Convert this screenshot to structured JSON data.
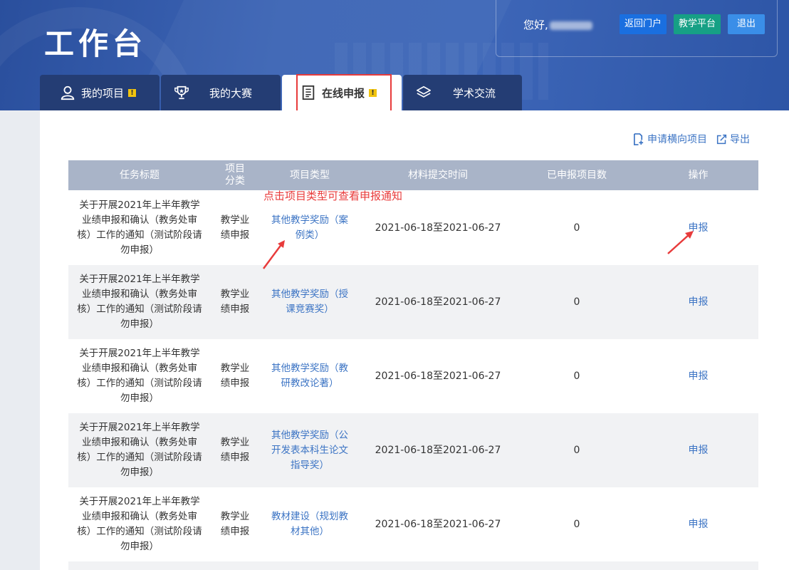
{
  "header": {
    "title": "工作台",
    "greeting": "您好,",
    "buttons": {
      "portal": "返回门户",
      "platform": "教学平台",
      "logout": "退出"
    }
  },
  "tabs": [
    {
      "label": "我的项目",
      "icon": "user-icon",
      "alert": "!"
    },
    {
      "label": "我的大赛",
      "icon": "trophy-icon"
    },
    {
      "label": "在线申报",
      "icon": "document-icon",
      "alert": "!",
      "active": true
    },
    {
      "label": "学术交流",
      "icon": "layers-icon"
    }
  ],
  "toolbar": {
    "apply_label": "申请横向项目",
    "export_label": "导出"
  },
  "annotation": "点击项目类型可查看申报通知",
  "table": {
    "headers": {
      "title": "任务标题",
      "category": "项目分类",
      "type": "项目类型",
      "time": "材料提交时间",
      "count": "已申报项目数",
      "op": "操作"
    },
    "rows": [
      {
        "title": "关于开展2021年上半年教学业绩申报和确认（教务处审核）工作的通知（测试阶段请勿申报）",
        "category": "教学业绩申报",
        "type": "其他教学奖励（案例类）",
        "time": "2021-06-18至2021-06-27",
        "count": "0",
        "op": "申报"
      },
      {
        "title": "关于开展2021年上半年教学业绩申报和确认（教务处审核）工作的通知（测试阶段请勿申报）",
        "category": "教学业绩申报",
        "type": "其他教学奖励（授课竞赛奖）",
        "time": "2021-06-18至2021-06-27",
        "count": "0",
        "op": "申报"
      },
      {
        "title": "关于开展2021年上半年教学业绩申报和确认（教务处审核）工作的通知（测试阶段请勿申报）",
        "category": "教学业绩申报",
        "type": "其他教学奖励（教研教改论著）",
        "time": "2021-06-18至2021-06-27",
        "count": "0",
        "op": "申报"
      },
      {
        "title": "关于开展2021年上半年教学业绩申报和确认（教务处审核）工作的通知（测试阶段请勿申报）",
        "category": "教学业绩申报",
        "type": "其他教学奖励（公开发表本科生论文指导奖）",
        "time": "2021-06-18至2021-06-27",
        "count": "0",
        "op": "申报"
      },
      {
        "title": "关于开展2021年上半年教学业绩申报和确认（教务处审核）工作的通知（测试阶段请勿申报）",
        "category": "教学业绩申报",
        "type": "教材建设（规划教材其他）",
        "time": "2021-06-18至2021-06-27",
        "count": "0",
        "op": "申报"
      }
    ]
  },
  "colors": {
    "accent": "#3c74c4",
    "header_bg": "#3c64b5",
    "tab_bg": "#243d74",
    "annotation": "#e83b3b",
    "table_head": "#a9b4c8"
  }
}
